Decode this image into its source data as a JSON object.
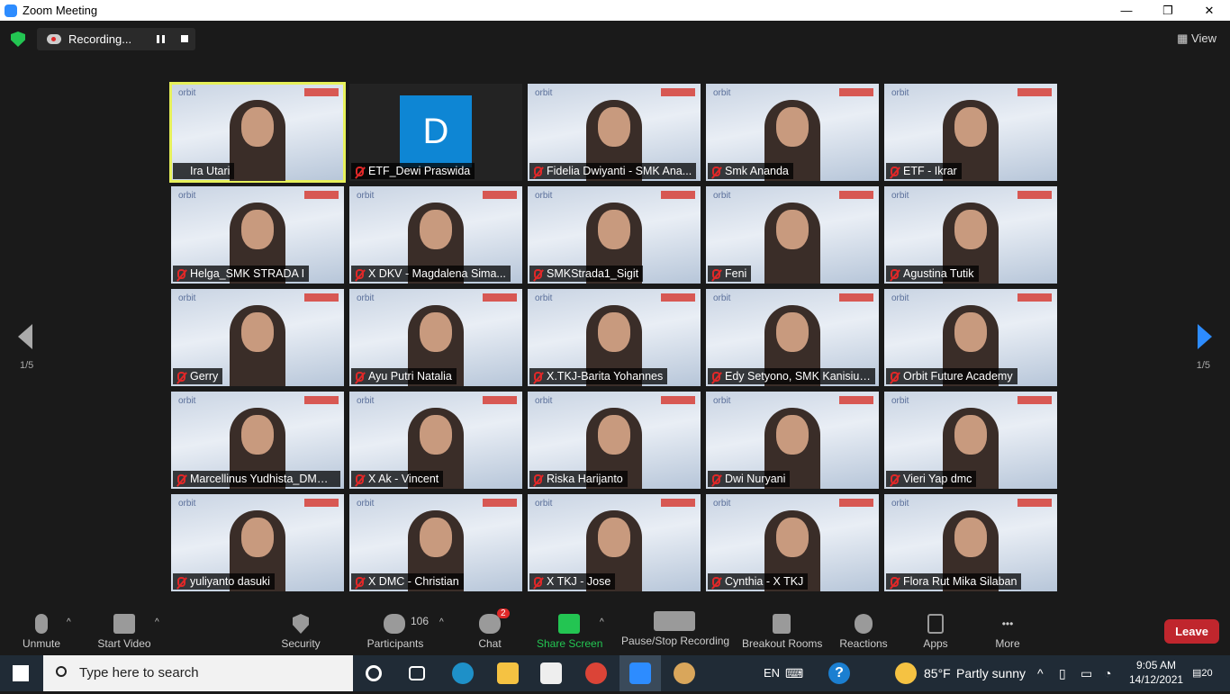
{
  "window": {
    "title": "Zoom Meeting",
    "minimize": "—",
    "maximize": "❐",
    "close": "✕"
  },
  "recording": {
    "label": "Recording..."
  },
  "view": {
    "label": "View"
  },
  "pagination": {
    "left": "1/5",
    "right": "1/5"
  },
  "tiles": [
    {
      "name": "Ira Utari",
      "active": true,
      "muted": false
    },
    {
      "name": "ETF_Dewi Praswida",
      "avatar": "D",
      "muted": true
    },
    {
      "name": "Fidelia Dwiyanti - SMK Ana...",
      "muted": true
    },
    {
      "name": "Smk Ananda",
      "muted": true
    },
    {
      "name": "ETF - Ikrar",
      "muted": true
    },
    {
      "name": "Helga_SMK STRADA I",
      "muted": true
    },
    {
      "name": "X DKV - Magdalena Sima...",
      "muted": true
    },
    {
      "name": "SMKStrada1_Sigit",
      "muted": true
    },
    {
      "name": "Feni",
      "muted": true
    },
    {
      "name": "Agustina Tutik",
      "muted": true
    },
    {
      "name": "Gerry",
      "muted": true
    },
    {
      "name": "Ayu Putri Natalia",
      "muted": true
    },
    {
      "name": "X.TKJ-Barita Yohannes",
      "muted": true
    },
    {
      "name": "Edy Setyono, SMK Kanisius...",
      "muted": true
    },
    {
      "name": "Orbit Future Academy",
      "muted": true
    },
    {
      "name": "Marcellinus Yudhista_DMC ...",
      "muted": true
    },
    {
      "name": "X Ak - Vincent",
      "muted": true
    },
    {
      "name": "Riska Harijanto",
      "muted": true
    },
    {
      "name": "Dwi Nuryani",
      "muted": true
    },
    {
      "name": "Vieri Yap dmc",
      "muted": true
    },
    {
      "name": "yuliyanto dasuki",
      "muted": true
    },
    {
      "name": "X DMC - Christian",
      "muted": true
    },
    {
      "name": "X TKJ - Jose",
      "muted": true
    },
    {
      "name": "Cynthia - X TKJ",
      "muted": true
    },
    {
      "name": "Flora Rut Mika Silaban",
      "muted": true
    }
  ],
  "toolbar": {
    "unmute": "Unmute",
    "start_video": "Start Video",
    "security": "Security",
    "participants": "Participants",
    "participants_count": "106",
    "chat": "Chat",
    "chat_badge": "2",
    "share_screen": "Share Screen",
    "recording": "Pause/Stop Recording",
    "breakout": "Breakout Rooms",
    "reactions": "Reactions",
    "apps": "Apps",
    "more": "More",
    "leave": "Leave",
    "share_color": "#23c552",
    "leave_color": "#c0262d"
  },
  "taskbar": {
    "search_placeholder": "Type here to search",
    "lang": "EN",
    "temp": "85°F",
    "weather": "Partly sunny",
    "time": "9:05 AM",
    "date": "14/12/2021",
    "notifications": "20"
  }
}
